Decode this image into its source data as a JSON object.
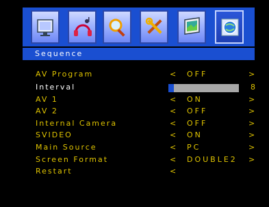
{
  "tabs": [
    {
      "icon": "picture-icon",
      "active": false
    },
    {
      "icon": "audio-icon",
      "active": false
    },
    {
      "icon": "search-icon",
      "active": false
    },
    {
      "icon": "settings-tools-icon",
      "active": false
    },
    {
      "icon": "display-icon",
      "active": false
    },
    {
      "icon": "globe-icon",
      "active": true
    }
  ],
  "header": {
    "title": "Sequence"
  },
  "menu": {
    "items": [
      {
        "label": "AV Program",
        "value": "OFF",
        "arrows": true
      },
      {
        "label": "Interval",
        "slider_value": "8",
        "slider_fraction": 0.08,
        "selected": true
      },
      {
        "label": "AV 1",
        "value": "ON",
        "arrows": true
      },
      {
        "label": "AV 2",
        "value": "OFF",
        "arrows": true
      },
      {
        "label": "Internal Camera",
        "value": "OFF",
        "arrows": true
      },
      {
        "label": "SVIDEO",
        "value": "ON",
        "arrows": true
      },
      {
        "label": "Main Source",
        "value": "PC",
        "arrows": true
      },
      {
        "label": "Screen Format",
        "value": "DOUBLE2",
        "arrows": true
      },
      {
        "label": "Restart",
        "value": "",
        "arrows": false
      }
    ],
    "left_arrow": "<",
    "right_arrow": ">"
  },
  "colors": {
    "accent": "#1a4fd1",
    "text": "#e0c400",
    "selected_text": "#ffffff",
    "slider_track": "#a8a8a8"
  }
}
